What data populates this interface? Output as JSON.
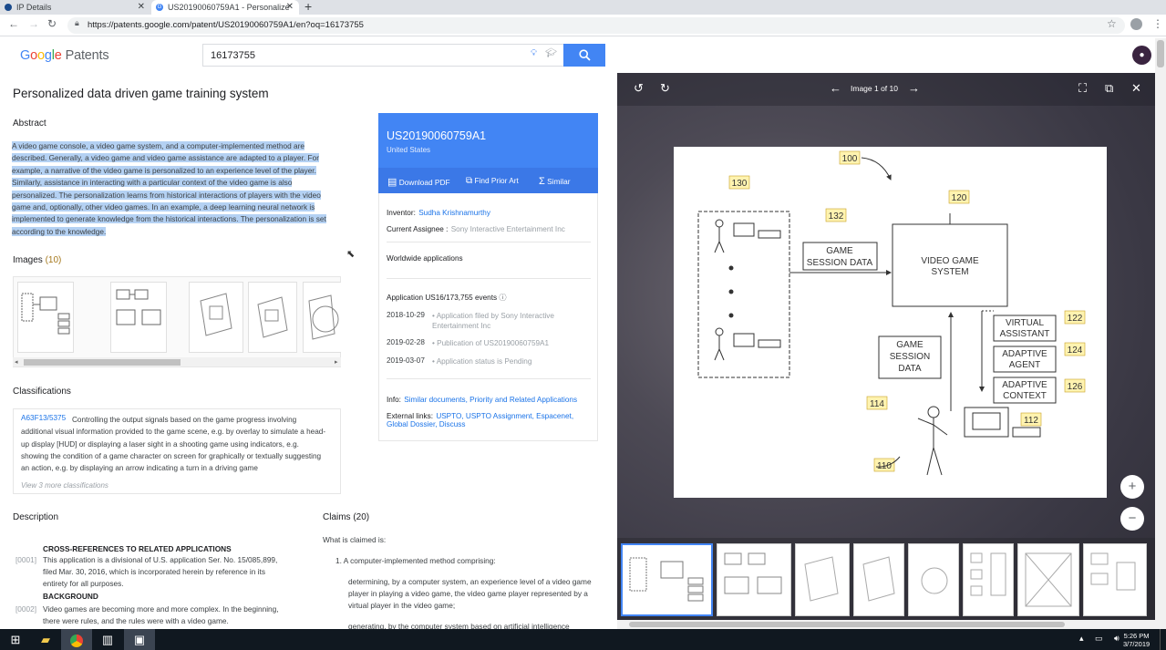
{
  "browser": {
    "tabs": [
      {
        "title": "IP Details",
        "active": false
      },
      {
        "title": "US20190060759A1 - Personalize",
        "active": true
      }
    ],
    "url": "https://patents.google.com/patent/US20190060759A1/en?oq=16173755"
  },
  "header": {
    "logo_google": "Google",
    "logo_patents": "Patents",
    "search_value": "16173755"
  },
  "patent": {
    "title": "Personalized data driven game training system",
    "abstract_heading": "Abstract",
    "abstract": "A video game console, a video game system, and a computer-implemented method are described. Generally, a video game and video game assistance are adapted to a player. For example, a narrative of the video game is personalized to an experience level of the player. Similarly, assistance in interacting with a particular context of the video game is also personalized. The personalization learns from historical interactions of players with the video game and, optionally, other video games. In an example, a deep learning neural network is implemented to generate knowledge from the historical interactions. The personalization is set according to the knowledge.",
    "images_heading": "Images",
    "images_count": "(10)",
    "classifications_heading": "Classifications",
    "classification_code": "A63F13/5375",
    "classification_text": "Controlling the output signals based on the game progress involving additional visual information provided to the game scene, e.g. by overlay to simulate a head-up display [HUD] or displaying a laser sight in a shooting game using indicators, e.g. showing the condition of a game character on screen for graphically or textually suggesting an action, e.g. by displaying an arrow indicating a turn in a driving game",
    "classification_more": "View 3 more classifications",
    "description_heading": "Description",
    "cross_ref_heading": "CROSS-REFERENCES TO RELATED APPLICATIONS",
    "para1_num": "[0001]",
    "para1": "This application is a divisional of U.S. application Ser. No. 15/085,899, filed Mar. 30, 2016, which is incorporated herein by reference in its entirety for all purposes.",
    "background_heading": "BACKGROUND",
    "para2_num": "[0002]",
    "para2": "Video games are becoming more and more complex. In the beginning, there were rules, and the rules were with a video game.",
    "claims_heading": "Claims (20)",
    "claims_intro": "What is claimed is:",
    "claim1": "1. A computer-implemented method comprising:",
    "claim1a": "determining, by a computer system, an experience level of a video game player in playing a video game, the video game player represented by a virtual player in the video game;",
    "claim1b": "generating, by the computer system based on artificial intelligence"
  },
  "card": {
    "pub_number": "US20190060759A1",
    "country": "United States",
    "btn_pdf": "Download PDF",
    "btn_prior": "Find Prior Art",
    "btn_similar": "Similar",
    "inventor_label": "Inventor:",
    "inventor": "Sudha Krishnamurthy",
    "assignee_label": "Current Assignee :",
    "assignee": "Sony Interactive Entertainment Inc",
    "worldwide": "Worldwide applications",
    "events_heading": "Application US16/173,755 events",
    "events": [
      {
        "date": "2018-10-29",
        "text": "Application filed by Sony Interactive Entertainment Inc"
      },
      {
        "date": "2019-02-28",
        "text": "Publication of US20190060759A1"
      },
      {
        "date": "2019-03-07",
        "text": "Application status is Pending"
      }
    ],
    "info_label": "Info:",
    "info_links": "Similar documents, Priority and Related Applications",
    "external_label": "External links:",
    "external_links_1": "USPTO, USPTO Assignment, Espacenet,",
    "external_links_2": "Global Dossier, Discuss"
  },
  "viewer": {
    "label": "Image 1 of 10",
    "figure_labels": {
      "n100": "100",
      "n130": "130",
      "n132": "132",
      "n120": "120",
      "n122": "122",
      "n124": "124",
      "n126": "126",
      "n114": "114",
      "n112": "112",
      "n110": "110",
      "game_session_data_1": "GAME",
      "game_session_data_2": "SESSION DATA",
      "video_game_1": "VIDEO GAME",
      "video_game_2": "SYSTEM",
      "virtual_1": "VIRTUAL",
      "virtual_2": "ASSISTANT",
      "adaptive_agent_1": "ADAPTIVE",
      "adaptive_agent_2": "AGENT",
      "adaptive_context_1": "ADAPTIVE",
      "adaptive_context_2": "CONTEXT",
      "gsd2_1": "GAME",
      "gsd2_2": "SESSION",
      "gsd2_3": "DATA"
    }
  },
  "taskbar": {
    "time": "5:26 PM",
    "date": "3/7/2019"
  }
}
